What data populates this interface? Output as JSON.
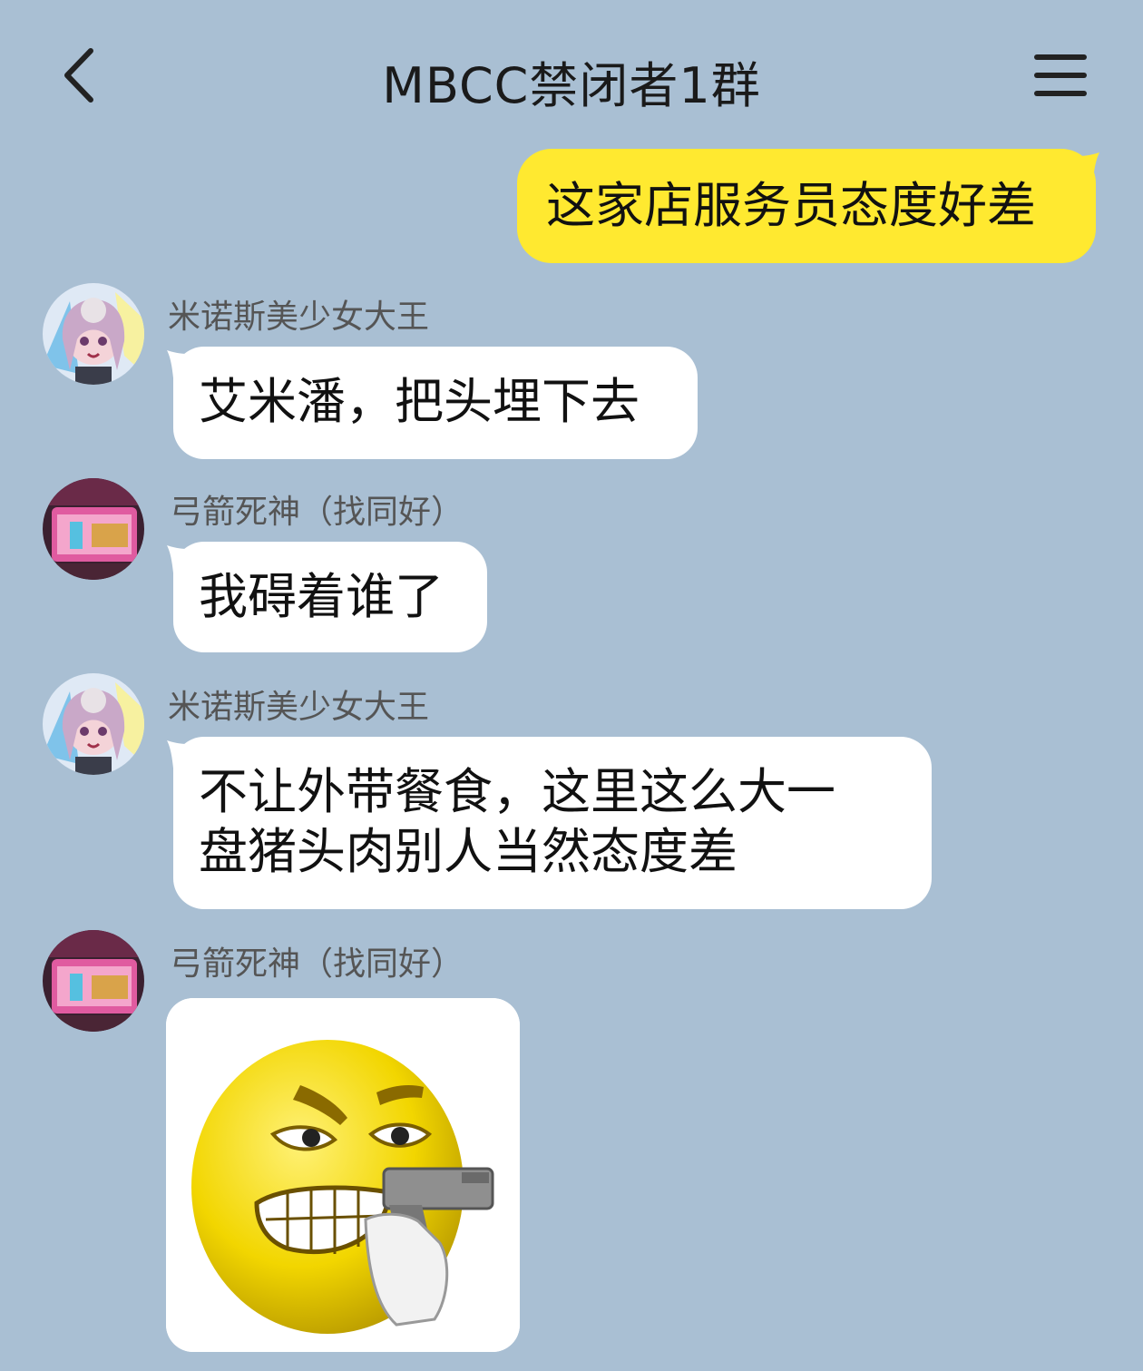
{
  "header": {
    "title": "MBCC禁闭者1群",
    "back_icon": "chevron-left-icon",
    "menu_icon": "hamburger-menu-icon"
  },
  "colors": {
    "background": "#a9bfd3",
    "self_bubble": "#ffe930",
    "other_bubble": "#ffffff"
  },
  "messages": [
    {
      "from": "self",
      "text": "这家店服务员态度好差"
    },
    {
      "from": "other",
      "sender": "米诺斯美少女大王",
      "avatar": "anime-girl-avatar",
      "text": "艾米潘，把头埋下去"
    },
    {
      "from": "other",
      "sender": "弓箭死神（找同好）",
      "avatar": "pink-sign-avatar",
      "text": "我碍着谁了"
    },
    {
      "from": "other",
      "sender": "米诺斯美少女大王",
      "avatar": "anime-girl-avatar",
      "lines": [
        "不让外带餐食，这里这么大一",
        "盘猪头肉别人当然态度差"
      ]
    },
    {
      "from": "other",
      "sender": "弓箭死神（找同好）",
      "avatar": "pink-sign-avatar",
      "image": "angry-emoji-with-gun-sticker"
    }
  ]
}
